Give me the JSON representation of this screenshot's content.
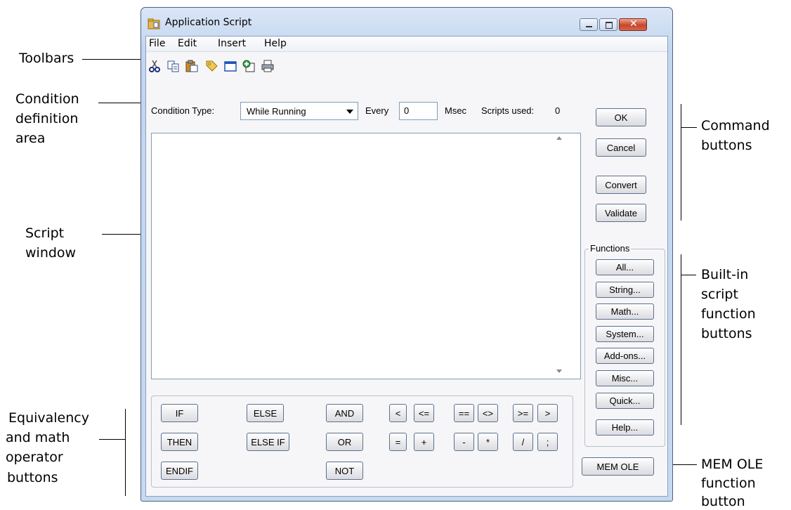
{
  "annotations": {
    "toolbars": "Toolbars",
    "condition": [
      "Condition",
      "definition",
      "area"
    ],
    "script": [
      "Script",
      "window"
    ],
    "equivalency": [
      "Equivalency",
      "and math",
      "operator",
      "buttons"
    ],
    "command": [
      "Command",
      "buttons"
    ],
    "builtin": [
      "Built-in",
      "script",
      "function",
      "buttons"
    ],
    "memole": [
      "MEM OLE",
      "function",
      "button"
    ]
  },
  "window": {
    "title": "Application Script"
  },
  "menu": [
    "File",
    "Edit",
    "Insert",
    "Help"
  ],
  "toolbar": [
    "cut-icon",
    "copy-icon",
    "paste-icon",
    "tag-icon",
    "window-icon",
    "insert-object-icon",
    "print-icon"
  ],
  "condition": {
    "type_label": "Condition Type:",
    "type_value": "While Running",
    "every_label": "Every",
    "every_value": "0",
    "msec_label": "Msec",
    "scripts_used_label": "Scripts used:",
    "scripts_used_value": "0"
  },
  "commands": {
    "ok": "OK",
    "cancel": "Cancel",
    "convert": "Convert",
    "validate": "Validate"
  },
  "functions": {
    "title": "Functions",
    "buttons": [
      "All...",
      "String...",
      "Math...",
      "System...",
      "Add-ons...",
      "Misc...",
      "Quick...",
      "Help..."
    ]
  },
  "memole": "MEM OLE",
  "operators": {
    "if": "IF",
    "then": "THEN",
    "endif": "ENDIF",
    "else": "ELSE",
    "elseif": "ELSE IF",
    "and": "AND",
    "or": "OR",
    "not": "NOT",
    "lt": "<",
    "le": "<=",
    "eq": "==",
    "ne": "<>",
    "ge": ">=",
    "gt": ">",
    "assign": "=",
    "plus": "+",
    "minus": "-",
    "mul": "*",
    "div": "/",
    "semi": ";"
  },
  "colors": {
    "frame": "#c6d9f0",
    "close": "#c9452a"
  }
}
